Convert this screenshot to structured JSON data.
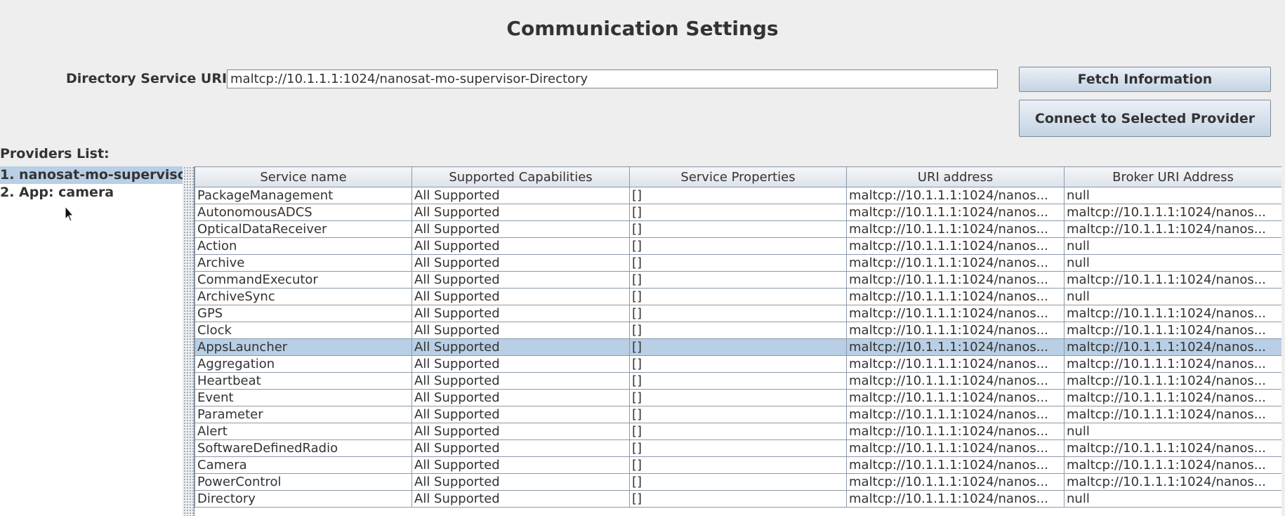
{
  "title": "Communication Settings",
  "directory": {
    "label": "Directory Service URI:",
    "value": "maltcp://10.1.1.1:1024/nanosat-mo-supervisor-Directory"
  },
  "buttons": {
    "fetch": "Fetch Information",
    "connect": "Connect to Selected Provider"
  },
  "providers": {
    "label": "Providers List:",
    "items": [
      "1. nanosat-mo-superviso",
      "2. App: camera"
    ]
  },
  "table": {
    "columns": [
      "Service name",
      "Supported Capabilities",
      "Service Properties",
      "URI address",
      "Broker URI Address"
    ],
    "rows": [
      [
        "PackageManagement",
        "All Supported",
        "[]",
        "maltcp://10.1.1.1:1024/nanos...",
        "null"
      ],
      [
        "AutonomousADCS",
        "All Supported",
        "[]",
        "maltcp://10.1.1.1:1024/nanos...",
        "maltcp://10.1.1.1:1024/nanos..."
      ],
      [
        "OpticalDataReceiver",
        "All Supported",
        "[]",
        "maltcp://10.1.1.1:1024/nanos...",
        "maltcp://10.1.1.1:1024/nanos..."
      ],
      [
        "Action",
        "All Supported",
        "[]",
        "maltcp://10.1.1.1:1024/nanos...",
        "null"
      ],
      [
        "Archive",
        "All Supported",
        "[]",
        "maltcp://10.1.1.1:1024/nanos...",
        "null"
      ],
      [
        "CommandExecutor",
        "All Supported",
        "[]",
        "maltcp://10.1.1.1:1024/nanos...",
        "maltcp://10.1.1.1:1024/nanos..."
      ],
      [
        "ArchiveSync",
        "All Supported",
        "[]",
        "maltcp://10.1.1.1:1024/nanos...",
        "null"
      ],
      [
        "GPS",
        "All Supported",
        "[]",
        "maltcp://10.1.1.1:1024/nanos...",
        "maltcp://10.1.1.1:1024/nanos..."
      ],
      [
        "Clock",
        "All Supported",
        "[]",
        "maltcp://10.1.1.1:1024/nanos...",
        "maltcp://10.1.1.1:1024/nanos..."
      ],
      [
        "AppsLauncher",
        "All Supported",
        "[]",
        "maltcp://10.1.1.1:1024/nanos...",
        "maltcp://10.1.1.1:1024/nanos..."
      ],
      [
        "Aggregation",
        "All Supported",
        "[]",
        "maltcp://10.1.1.1:1024/nanos...",
        "maltcp://10.1.1.1:1024/nanos..."
      ],
      [
        "Heartbeat",
        "All Supported",
        "[]",
        "maltcp://10.1.1.1:1024/nanos...",
        "maltcp://10.1.1.1:1024/nanos..."
      ],
      [
        "Event",
        "All Supported",
        "[]",
        "maltcp://10.1.1.1:1024/nanos...",
        "maltcp://10.1.1.1:1024/nanos..."
      ],
      [
        "Parameter",
        "All Supported",
        "[]",
        "maltcp://10.1.1.1:1024/nanos...",
        "maltcp://10.1.1.1:1024/nanos..."
      ],
      [
        "Alert",
        "All Supported",
        "[]",
        "maltcp://10.1.1.1:1024/nanos...",
        "null"
      ],
      [
        "SoftwareDefinedRadio",
        "All Supported",
        "[]",
        "maltcp://10.1.1.1:1024/nanos...",
        "maltcp://10.1.1.1:1024/nanos..."
      ],
      [
        "Camera",
        "All Supported",
        "[]",
        "maltcp://10.1.1.1:1024/nanos...",
        "maltcp://10.1.1.1:1024/nanos..."
      ],
      [
        "PowerControl",
        "All Supported",
        "[]",
        "maltcp://10.1.1.1:1024/nanos...",
        "maltcp://10.1.1.1:1024/nanos..."
      ],
      [
        "Directory",
        "All Supported",
        "[]",
        "maltcp://10.1.1.1:1024/nanos...",
        "null"
      ]
    ]
  },
  "icons": {
    "cursor": "mouse-pointer-icon"
  },
  "colors": {
    "selection": "#b8cfe5",
    "background": "#eeeeee"
  }
}
